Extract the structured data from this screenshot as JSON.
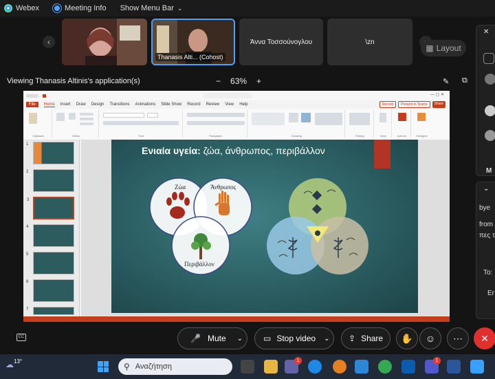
{
  "topbar": {
    "app_name": "Webex",
    "meeting_info": "Meeting Info",
    "show_menu_bar": "Show Menu Bar"
  },
  "participants": [
    {
      "name": ""
    },
    {
      "name": "Thanasis Alti... (Cohost)"
    },
    {
      "name": "Άννα Τοσσούνογλου"
    },
    {
      "name": "\\zn"
    }
  ],
  "layout_label": "Layout",
  "viewing": {
    "title": "Viewing Thanasis Altinis's application(s)",
    "zoom": "63%"
  },
  "ppt": {
    "tabs": [
      "File",
      "Home",
      "Insert",
      "Draw",
      "Design",
      "Transitions",
      "Animations",
      "Slide Show",
      "Record",
      "Review",
      "View",
      "Help"
    ],
    "active_tab": "Home",
    "record_btn": "Record",
    "present_btn": "Present in Teams",
    "share_btn": "Share",
    "groups": [
      "Clipboard",
      "Slides",
      "Font",
      "Paragraph",
      "Drawing",
      "Editing",
      "Voice",
      "Add-ins",
      "Designer"
    ],
    "slide_numbers": [
      "1",
      "2",
      "3",
      "4",
      "5",
      "6",
      "7"
    ],
    "slide": {
      "title_bold": "Ενιαία υγεία:",
      "title_rest": " ζώα, άνθρωπος, περιβάλλον",
      "circle_animals": "Ζώα",
      "circle_human": "Άνθρωπος",
      "circle_environment": "Περιβάλλον"
    }
  },
  "right_panel": {
    "text_bye": "bye",
    "text_from": "from",
    "text_pes": "πες τ",
    "text_to": "To:",
    "letter_m": "M",
    "input_fragment": "Er"
  },
  "controls": {
    "mute": "Mute",
    "stop_video": "Stop video",
    "share": "Share"
  },
  "taskbar": {
    "temperature": "13°",
    "search_placeholder": "Αναζήτηση",
    "badge_teams": "1",
    "badge_teams2": "1"
  },
  "colors": {
    "accent_red": "#e0302d",
    "ppt_orange": "#c43e1c",
    "slide_teal": "#2e6468"
  }
}
